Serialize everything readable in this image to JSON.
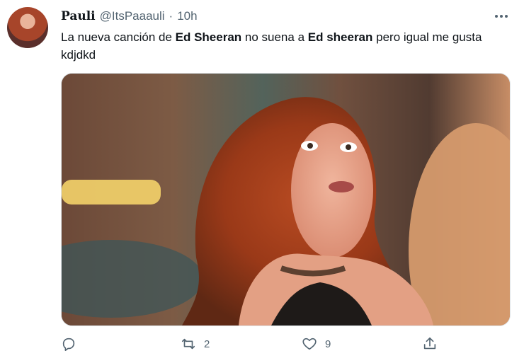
{
  "tweet": {
    "display_name": "Pauli",
    "handle": "@ItsPaaauli",
    "separator": "·",
    "time": "10h",
    "text_parts": [
      "La nueva canción de ",
      "Ed Sheeran",
      " no suena a ",
      "Ed sheeran",
      " pero igual me gusta kdjdkd"
    ]
  },
  "actions": {
    "reply": "",
    "retweet": "2",
    "like": "9",
    "share": ""
  }
}
